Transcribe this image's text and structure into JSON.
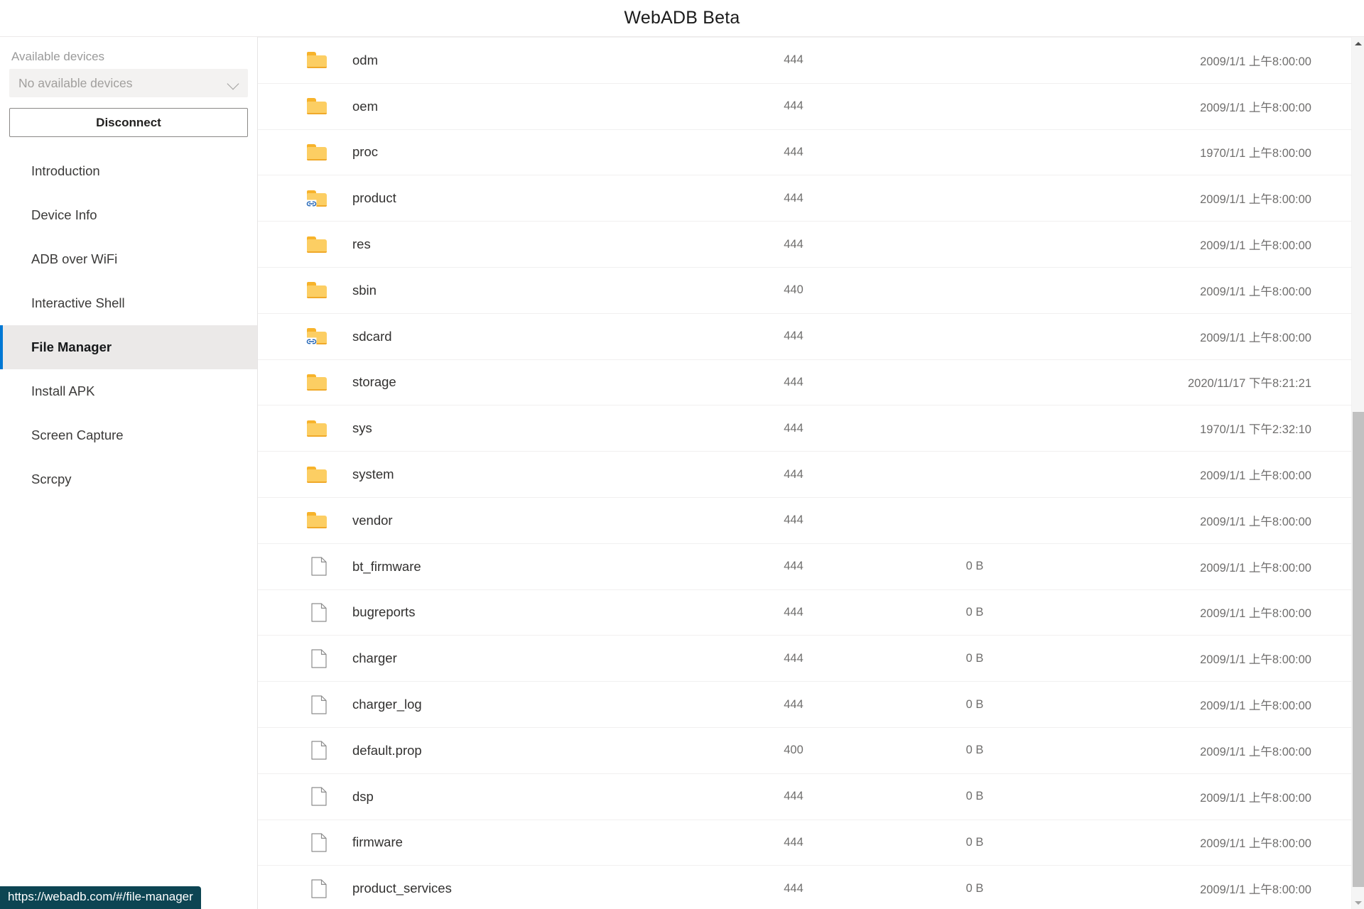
{
  "header": {
    "title": "WebADB Beta"
  },
  "sidebar": {
    "available_devices_label": "Available devices",
    "device_select": {
      "value": "No available devices",
      "icon": "chevron-down-icon"
    },
    "disconnect_label": "Disconnect",
    "items": [
      {
        "label": "Introduction",
        "selected": false
      },
      {
        "label": "Device Info",
        "selected": false
      },
      {
        "label": "ADB over WiFi",
        "selected": false
      },
      {
        "label": "Interactive Shell",
        "selected": false
      },
      {
        "label": "File Manager",
        "selected": true
      },
      {
        "label": "Install APK",
        "selected": false
      },
      {
        "label": "Screen Capture",
        "selected": false
      },
      {
        "label": "Scrcpy",
        "selected": false
      }
    ]
  },
  "statusbar": {
    "url": "https://webadb.com/#/file-manager"
  },
  "colors": {
    "accent": "#0078d4",
    "selected_row_bg": "#ebe9e8",
    "folder": "#fcce63",
    "folder_tab": "#f7b32b",
    "link_badge": "#1a5fb4",
    "statusbar_bg": "#0d4553",
    "text": "#323130",
    "muted_text": "#6f6e6d"
  },
  "file_list": {
    "rows": [
      {
        "icon": "folder-icon",
        "name": "odm",
        "permission": "444",
        "size": "",
        "modified": "2009/1/1 上午8:00:00"
      },
      {
        "icon": "folder-icon",
        "name": "oem",
        "permission": "444",
        "size": "",
        "modified": "2009/1/1 上午8:00:00"
      },
      {
        "icon": "folder-icon",
        "name": "proc",
        "permission": "444",
        "size": "",
        "modified": "1970/1/1 上午8:00:00"
      },
      {
        "icon": "folder-link-icon",
        "name": "product",
        "permission": "444",
        "size": "",
        "modified": "2009/1/1 上午8:00:00"
      },
      {
        "icon": "folder-icon",
        "name": "res",
        "permission": "444",
        "size": "",
        "modified": "2009/1/1 上午8:00:00"
      },
      {
        "icon": "folder-icon",
        "name": "sbin",
        "permission": "440",
        "size": "",
        "modified": "2009/1/1 上午8:00:00"
      },
      {
        "icon": "folder-link-icon",
        "name": "sdcard",
        "permission": "444",
        "size": "",
        "modified": "2009/1/1 上午8:00:00"
      },
      {
        "icon": "folder-icon",
        "name": "storage",
        "permission": "444",
        "size": "",
        "modified": "2020/11/17 下午8:21:21"
      },
      {
        "icon": "folder-icon",
        "name": "sys",
        "permission": "444",
        "size": "",
        "modified": "1970/1/1 下午2:32:10"
      },
      {
        "icon": "folder-icon",
        "name": "system",
        "permission": "444",
        "size": "",
        "modified": "2009/1/1 上午8:00:00"
      },
      {
        "icon": "folder-icon",
        "name": "vendor",
        "permission": "444",
        "size": "",
        "modified": "2009/1/1 上午8:00:00"
      },
      {
        "icon": "file-icon",
        "name": "bt_firmware",
        "permission": "444",
        "size": "0 B",
        "modified": "2009/1/1 上午8:00:00"
      },
      {
        "icon": "file-icon",
        "name": "bugreports",
        "permission": "444",
        "size": "0 B",
        "modified": "2009/1/1 上午8:00:00"
      },
      {
        "icon": "file-icon",
        "name": "charger",
        "permission": "444",
        "size": "0 B",
        "modified": "2009/1/1 上午8:00:00"
      },
      {
        "icon": "file-icon",
        "name": "charger_log",
        "permission": "444",
        "size": "0 B",
        "modified": "2009/1/1 上午8:00:00"
      },
      {
        "icon": "file-icon",
        "name": "default.prop",
        "permission": "400",
        "size": "0 B",
        "modified": "2009/1/1 上午8:00:00"
      },
      {
        "icon": "file-icon",
        "name": "dsp",
        "permission": "444",
        "size": "0 B",
        "modified": "2009/1/1 上午8:00:00"
      },
      {
        "icon": "file-icon",
        "name": "firmware",
        "permission": "444",
        "size": "0 B",
        "modified": "2009/1/1 上午8:00:00"
      },
      {
        "icon": "file-icon",
        "name": "product_services",
        "permission": "444",
        "size": "0 B",
        "modified": "2009/1/1 上午8:00:00"
      }
    ]
  },
  "scrollbar": {
    "up_icon": "triangle-up-icon",
    "down_icon": "triangle-down-icon"
  }
}
